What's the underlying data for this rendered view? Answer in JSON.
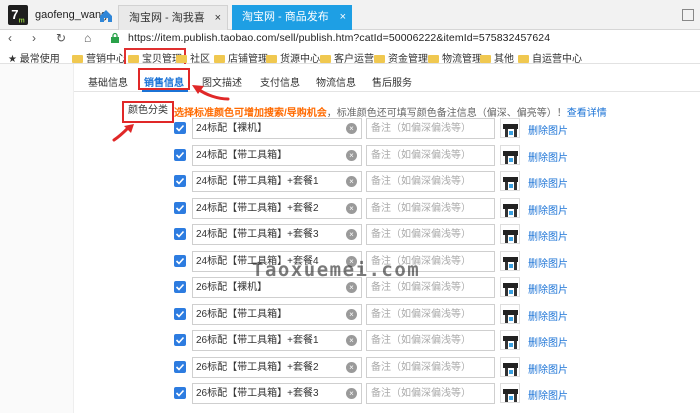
{
  "app": {
    "logo_text": "7",
    "logo_sub": "m",
    "user": "gaofeng_wang"
  },
  "tabs": [
    {
      "label": "淘宝网 - 淘我喜欢！",
      "close": "×"
    },
    {
      "label": "淘宝网 - 商品发布",
      "close": "×"
    }
  ],
  "address": {
    "url": "https://item.publish.taobao.com/sell/publish.htm?catId=50006222&itemId=575832457624"
  },
  "bookmarks": [
    "最常使用",
    "营销中心",
    "宝贝管理",
    "社区",
    "店铺管理",
    "货源中心",
    "客户运营",
    "资金管理",
    "物流管理",
    "其他",
    "自运营中心"
  ],
  "nav": {
    "tabs": [
      "基础信息",
      "销售信息",
      "图文描述",
      "支付信息",
      "物流信息",
      "售后服务"
    ],
    "active": "销售信息"
  },
  "color_section": {
    "label": "颜色分类",
    "notice_warn": "选择标准颜色可增加搜索/导购机会",
    "notice_text": "，标准颜色还可填写颜色备注信息（偏深、偏亮等）！",
    "notice_link": "查看详情",
    "note_placeholder": "备注（如偏深偏浅等）",
    "delete_label": "删除图片",
    "rows": [
      "24标配【裸机】",
      "24标配【带工具箱】",
      "24标配【带工具箱】+套餐1",
      "24标配【带工具箱】+套餐2",
      "24标配【带工具箱】+套餐3",
      "24标配【带工具箱】+套餐4",
      "26标配【裸机】",
      "26标配【带工具箱】",
      "26标配【带工具箱】+套餐1",
      "26标配【带工具箱】+套餐2",
      "26标配【带工具箱】+套餐3"
    ]
  },
  "watermark": "Taoxuemei.com",
  "colors": {
    "accent": "#1b73d6",
    "tab_active": "#1e9fe4",
    "highlight": "#e02828",
    "warning": "#ff6a00"
  }
}
